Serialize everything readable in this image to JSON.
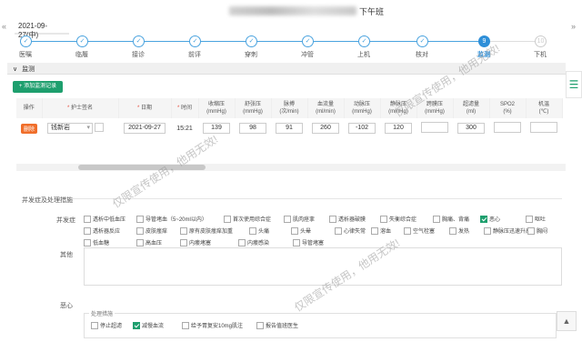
{
  "header": {
    "shift": "下午班",
    "date_tab": "2021-09-27(中)",
    "left_arrow": "«",
    "right_arrow": "»"
  },
  "steps": [
    {
      "label": "医嘱",
      "mark": "✓"
    },
    {
      "label": "临履",
      "mark": "✓"
    },
    {
      "label": "接诊",
      "mark": "✓"
    },
    {
      "label": "前评",
      "mark": "✓"
    },
    {
      "label": "穿刺",
      "mark": "✓"
    },
    {
      "label": "冲管",
      "mark": "✓"
    },
    {
      "label": "上机",
      "mark": "✓"
    },
    {
      "label": "核对",
      "mark": "✓"
    },
    {
      "label": "监测",
      "mark": "9"
    },
    {
      "label": "下机",
      "mark": "10"
    }
  ],
  "section": {
    "title": "监测",
    "add_button": "+ 添加监测记录"
  },
  "table": {
    "headers": [
      "操作",
      "* 护士签名",
      "* 日期",
      "* 时间",
      "收缩压 (mmHg)",
      "舒张压 (mmHg)",
      "脉搏 (次/min)",
      "血流量 (ml/min)",
      "动脉压 (mmHg)",
      "静脉压 (mmHg)",
      "跨膜压 (mmHg)",
      "超滤量 (ml)",
      "SPO2 (%)",
      "机温 (℃)"
    ],
    "row": {
      "delete": "删除",
      "nurse": "钱新岩",
      "date": "2021-09-27",
      "time": "15:21",
      "systolic": "139",
      "diastolic": "98",
      "pulse": "91",
      "blood_flow": "260",
      "arterial": "-102",
      "venous": "120",
      "tmp": "",
      "uf": "300",
      "spo2": "",
      "temp": ""
    }
  },
  "complications": {
    "title": "并发症及处理措施",
    "label": "并发症",
    "row1": [
      {
        "t": "透析中低血压",
        "c": false
      },
      {
        "t": "导管堵血（5~20ml以内）",
        "c": false
      },
      {
        "t": "首次使用综合症",
        "c": false
      },
      {
        "t": "肌肉痉挛",
        "c": false
      },
      {
        "t": "透析器破膜",
        "c": false
      },
      {
        "t": "失衡综合症",
        "c": false
      },
      {
        "t": "胸痛、背痛",
        "c": false
      },
      {
        "t": "恶心",
        "c": true
      },
      {
        "t": "呕吐",
        "c": false
      }
    ],
    "row2": [
      {
        "t": "透析器反应",
        "c": false
      },
      {
        "t": "皮肤瘙痒",
        "c": false
      },
      {
        "t": "原有皮肤瘙痒加重",
        "c": false
      },
      {
        "t": "头痛",
        "c": false
      },
      {
        "t": "头晕",
        "c": false
      },
      {
        "t": "心律失常",
        "c": false
      },
      {
        "t": "溶血",
        "c": false
      },
      {
        "t": "空气栓塞",
        "c": false
      },
      {
        "t": "发热",
        "c": false
      },
      {
        "t": "静脉压迅速升高",
        "c": false
      },
      {
        "t": "胸闷",
        "c": false
      }
    ],
    "row3": [
      {
        "t": "低血糖",
        "c": false
      },
      {
        "t": "高血压",
        "c": false
      },
      {
        "t": "内瘘堵塞",
        "c": false
      },
      {
        "t": "内瘘感染",
        "c": false
      },
      {
        "t": "导管堵塞",
        "c": false
      }
    ],
    "other_label": "其他",
    "nausea_label": "恶心",
    "measures_title": "处理措施",
    "measures": [
      {
        "t": "停止超滤",
        "c": false
      },
      {
        "t": "减慢血流",
        "c": true
      },
      {
        "t": "给予胃复安10mg肌注",
        "c": false
      },
      {
        "t": "报告值班医生",
        "c": false
      }
    ]
  },
  "watermark": "仅限宣传使用，他用无效!",
  "colors": {
    "accent": "#2e8fd8",
    "brand_green": "#1e9f6e",
    "delete": "#f06e2a"
  }
}
